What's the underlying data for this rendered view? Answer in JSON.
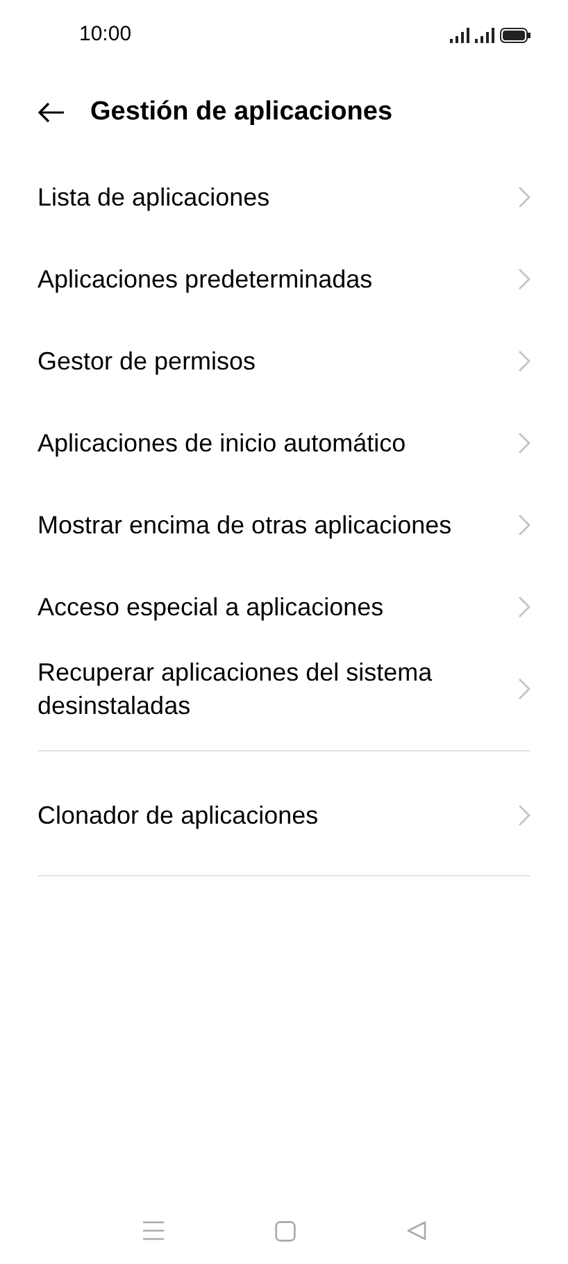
{
  "status_bar": {
    "time": "10:00"
  },
  "header": {
    "title": "Gestión de aplicaciones"
  },
  "groups": [
    {
      "items": [
        {
          "label": "Lista de aplicaciones"
        },
        {
          "label": "Aplicaciones predeterminadas"
        },
        {
          "label": "Gestor de permisos"
        },
        {
          "label": "Aplicaciones de inicio automático"
        },
        {
          "label": "Mostrar encima de otras aplicaciones"
        },
        {
          "label": "Acceso especial a aplicaciones"
        },
        {
          "label": "Recuperar aplicaciones del sistema desinstaladas"
        }
      ]
    },
    {
      "items": [
        {
          "label": "Clonador de aplicaciones"
        }
      ]
    }
  ]
}
